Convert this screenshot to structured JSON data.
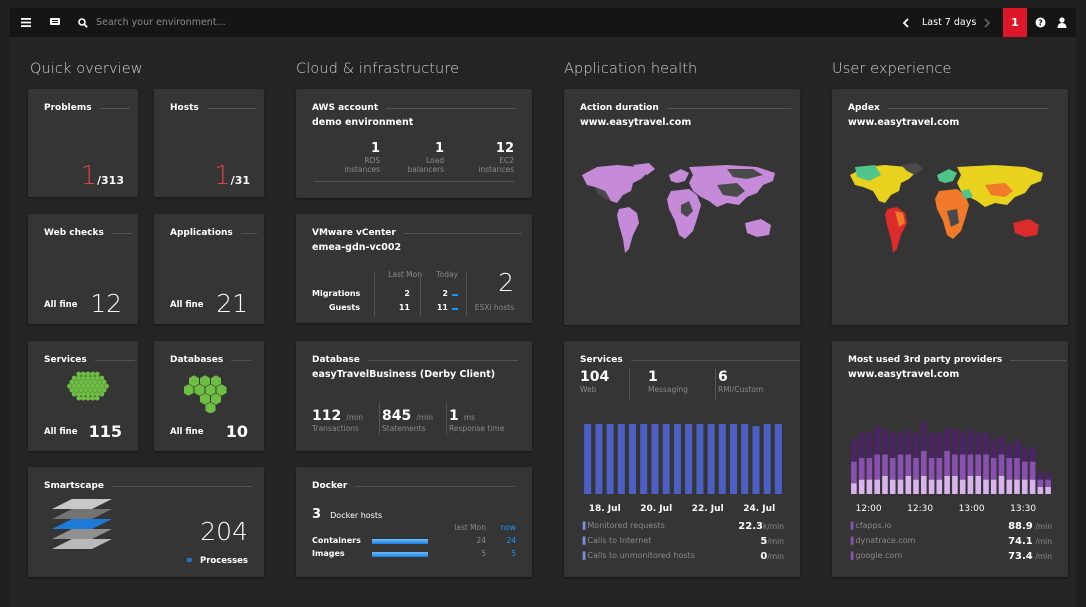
{
  "header": {
    "menu_icon": "hamburger-icon",
    "chat_icon": "chat-icon",
    "search_icon": "search-icon",
    "search_placeholder": "Search your environment...",
    "time_range": "Last 7 days",
    "prev_icon": "chevron-left-icon",
    "next_icon": "chevron-right-icon",
    "problems_badge": "1",
    "help_icon": "help-icon",
    "user_icon": "user-icon"
  },
  "sections": {
    "quick": "Quick overview",
    "cloud": "Cloud & infrastructure",
    "app": "Application health",
    "ux": "User experience"
  },
  "problems": {
    "title": "Problems",
    "count": "1",
    "total": "/313"
  },
  "hosts": {
    "title": "Hosts",
    "count": "1",
    "total": "/31"
  },
  "webchecks": {
    "title": "Web checks",
    "status": "All fine",
    "value": "12"
  },
  "applications": {
    "title": "Applications",
    "status": "All fine",
    "value": "21"
  },
  "services_tile": {
    "title": "Services",
    "status": "All fine",
    "value": "115",
    "accent": "#6fbe44"
  },
  "databases_tile": {
    "title": "Databases",
    "status": "All fine",
    "value": "10",
    "accent": "#6fbe44"
  },
  "smartscape": {
    "title": "Smartscape",
    "value": "204",
    "label": "Processes",
    "link_icon": "link-icon"
  },
  "aws": {
    "title": "AWS account",
    "subtitle": "demo environment",
    "metrics": [
      {
        "value": "1",
        "label1": "RDS",
        "label2": "instances"
      },
      {
        "value": "1",
        "label1": "Load",
        "label2": "balancers"
      },
      {
        "value": "12",
        "label1": "EC2",
        "label2": "instances"
      }
    ]
  },
  "vmware": {
    "title": "VMware vCenter",
    "subtitle": "emea-gdn-vc002",
    "col1": "Last Mon",
    "col2": "Today",
    "rows": [
      {
        "label": "Migrations",
        "last": "2",
        "today": "2"
      },
      {
        "label": "Guests",
        "last": "11",
        "today": "11"
      }
    ],
    "esxi_value": "2",
    "esxi_label": "ESXi hosts"
  },
  "database": {
    "title": "Database",
    "subtitle": "easyTravelBusiness (Derby Client)",
    "metrics": [
      {
        "value": "112",
        "unit": "/min",
        "label": "Transactions"
      },
      {
        "value": "845",
        "unit": "/min",
        "label": "Statements"
      },
      {
        "value": "1",
        "unit": "ms",
        "label": "Response time"
      }
    ]
  },
  "docker": {
    "title": "Docker",
    "hosts_value": "3",
    "hosts_label": "Docker hosts",
    "col1": "last Mon",
    "col2": "now",
    "rows": [
      {
        "label": "Containers",
        "last": "24",
        "now": "24"
      },
      {
        "label": "Images",
        "last": "5",
        "now": "5"
      }
    ]
  },
  "action_duration": {
    "title": "Action duration",
    "subtitle": "www.easytravel.com",
    "map_color": "#c58bd9"
  },
  "services_chart": {
    "title": "Services",
    "counts": [
      {
        "value": "104",
        "label": "Web"
      },
      {
        "value": "1",
        "label": "Messaging"
      },
      {
        "value": "6",
        "label": "RMI/Custom"
      }
    ],
    "legend": [
      {
        "label": "Monitored requests",
        "value": "22.3",
        "unit": "k/min"
      },
      {
        "label": "Calls to Internet",
        "value": "5",
        "unit": "/min"
      },
      {
        "label": "Calls to unmonitored hosts",
        "value": "0",
        "unit": "/min"
      }
    ]
  },
  "apdex": {
    "title": "Apdex",
    "subtitle": "www.easytravel.com"
  },
  "third_party": {
    "title": "Most used 3rd party providers",
    "subtitle": "www.easytravel.com",
    "legend": [
      {
        "label": "cfapps.io",
        "value": "88.9",
        "unit": "/min"
      },
      {
        "label": "dynatrace.com",
        "value": "74.1",
        "unit": "/min"
      },
      {
        "label": "google.com",
        "value": "73.4",
        "unit": "/min"
      }
    ]
  },
  "chart_data": [
    {
      "type": "bar",
      "title": "Services",
      "x_ticks": [
        "18. Jul",
        "20. Jul",
        "22. Jul",
        "24. Jul"
      ],
      "series": [
        {
          "values": [
            1,
            1,
            1,
            1,
            1,
            1,
            1,
            1,
            1,
            1,
            1,
            1,
            1,
            1,
            1,
            0.97,
            1,
            1
          ]
        }
      ],
      "color": "#4b5fc4"
    },
    {
      "type": "bar",
      "title": "Most used 3rd party providers",
      "x_ticks": [
        "12:00",
        "12:30",
        "13:00",
        "13:30"
      ],
      "series": [
        {
          "name": "cfapps.io",
          "values": [
            6,
            7,
            7,
            8,
            7,
            7,
            6,
            7,
            7,
            8,
            7,
            7,
            6,
            7,
            6,
            7,
            6,
            6,
            5,
            5,
            4,
            5,
            4,
            4,
            2,
            2
          ]
        },
        {
          "name": "dynatrace.com",
          "values": [
            6,
            6,
            6,
            7,
            6,
            6,
            7,
            6,
            6,
            7,
            6,
            6,
            7,
            6,
            7,
            6,
            6,
            7,
            6,
            6,
            6,
            6,
            5,
            5,
            2,
            2
          ]
        },
        {
          "name": "google.com",
          "values": [
            3,
            4,
            4,
            4,
            5,
            4,
            4,
            5,
            4,
            5,
            4,
            4,
            5,
            5,
            4,
            5,
            5,
            4,
            4,
            5,
            4,
            4,
            4,
            4,
            2,
            2
          ]
        }
      ],
      "colors": [
        "#4b2466",
        "#8a4fb3",
        "#d9b3ec"
      ]
    }
  ]
}
